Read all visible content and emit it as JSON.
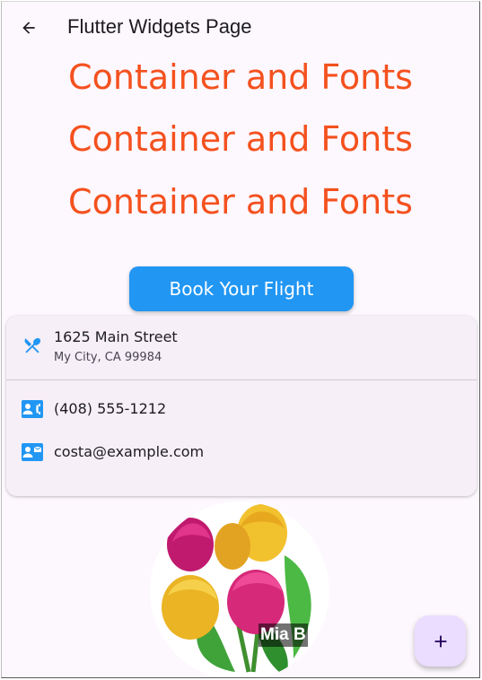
{
  "appbar": {
    "title": "Flutter Widgets Page",
    "back_icon": "arrow-back-icon"
  },
  "headlines": [
    "Container and Fonts",
    "Container and Fonts",
    "Container and Fonts"
  ],
  "book_button": {
    "label": "Book Your Flight"
  },
  "contact_card": {
    "address": {
      "icon": "restaurant-icon",
      "title": "1625 Main Street",
      "subtitle": "My City, CA 99984"
    },
    "phone": {
      "icon": "contact-phone-icon",
      "title": "(408) 555-1212"
    },
    "email": {
      "icon": "contact-mail-icon",
      "title": "costa@example.com"
    }
  },
  "avatar": {
    "label": "Mia B",
    "image": "tulips-bouquet"
  },
  "fab": {
    "icon": "add-icon"
  },
  "colors": {
    "headline": "#f4511e",
    "primary_button": "#2196f3",
    "icon_blue": "#2196f3",
    "fab_bg": "#eaddff",
    "page_bg": "#fdf7fe",
    "card_bg": "#f6eff7"
  }
}
